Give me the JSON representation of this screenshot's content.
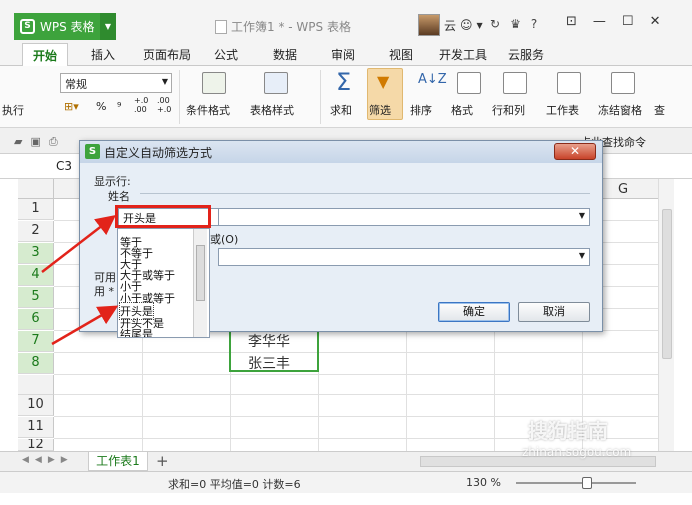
{
  "app": {
    "brand": "WPS 表格",
    "brand_logo": "S",
    "doc_title": "工作簿1 * - WPS 表格",
    "user": "云",
    "help_label": "?",
    "colors": {
      "accent": "#3da33c",
      "highlight": "#e2231a",
      "dialog_bg": "#e7eef6"
    }
  },
  "ribbon_tabs": [
    "开始",
    "插入",
    "页面布局",
    "公式",
    "数据",
    "审阅",
    "视图",
    "开发工具",
    "云服务"
  ],
  "ribbon": {
    "exec_label": "执行",
    "number_format": "常规",
    "percent": "%",
    "comma": "⁹",
    "inc_decimal": "+.0 .00",
    "dec_decimal": ".00 +.0",
    "cond_format": "条件格式",
    "table_style": "表格样式",
    "sum": "求和",
    "filter": "筛选",
    "sort": "排序",
    "format": "格式",
    "row_col": "行和列",
    "worksheet": "工作表",
    "freeze": "冻结窗格",
    "find": "查"
  },
  "quick_access": {
    "search_cmd": "点此查找命令"
  },
  "formula_bar": {
    "name_box": "C3"
  },
  "grid": {
    "visible_column": "G",
    "row_numbers": [
      "1",
      "2",
      "3",
      "4",
      "5",
      "6",
      "7",
      "8",
      "10",
      "11",
      "12"
    ],
    "cells": [
      "李华华",
      "张三丰"
    ]
  },
  "dialog": {
    "title": "自定义自动筛选方式",
    "close": "✕",
    "show_rows": "显示行:",
    "field": "姓名",
    "operator": "开头是",
    "or_label": "或(O)",
    "hint1": "可用",
    "hint2": "用 *",
    "ok": "确定",
    "cancel": "取消"
  },
  "dropdown_options": [
    "等于",
    "不等于",
    "大于",
    "大于或等于",
    "小于",
    "小于或等于",
    "开头是",
    "开头不是",
    "结尾是"
  ],
  "sheets": {
    "active": "工作表1",
    "add": "+"
  },
  "status": {
    "summary": "求和=0  平均值=0  计数=6",
    "zoom": "130 %"
  },
  "watermark": {
    "brand": "搜狗指南",
    "site": "zhinan.sogou.com"
  }
}
